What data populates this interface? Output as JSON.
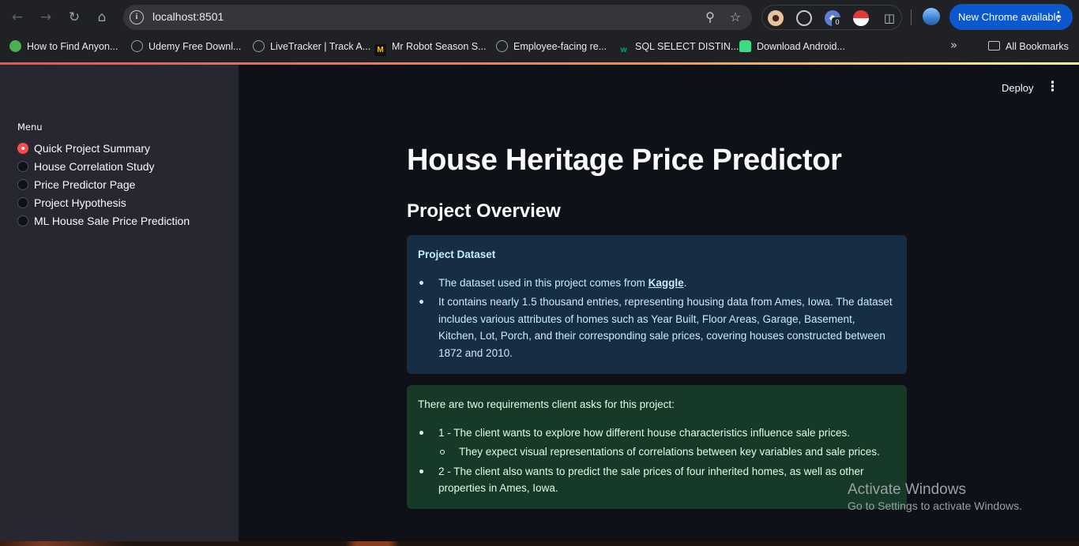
{
  "browser": {
    "url": "localhost:8501",
    "update_label": "New Chrome available",
    "extension_badge": "0",
    "bookmarks": [
      {
        "label": "How to Find Anyon...",
        "icon": "green-logo-icon",
        "color": "#4caf50"
      },
      {
        "label": "Udemy Free Downl...",
        "icon": "globe-icon",
        "color": "#9aa0a6"
      },
      {
        "label": "LiveTracker | Track A...",
        "icon": "globe-icon",
        "color": "#9aa0a6"
      },
      {
        "label": "Mr Robot Season S...",
        "icon": "m-logo-icon",
        "color": "#f4c20d"
      },
      {
        "label": "Employee-facing re...",
        "icon": "globe-icon",
        "color": "#9aa0a6"
      },
      {
        "label": "SQL SELECT DISTIN...",
        "icon": "w3-logo-icon",
        "color": "#04aa6d"
      },
      {
        "label": "Download Android...",
        "icon": "android-icon",
        "color": "#3ddc84"
      }
    ],
    "all_bookmarks_label": "All Bookmarks"
  },
  "sidebar": {
    "menu_title": "Menu",
    "items": [
      {
        "label": "Quick Project Summary",
        "selected": true
      },
      {
        "label": "House Correlation Study",
        "selected": false
      },
      {
        "label": "Price Predictor Page",
        "selected": false
      },
      {
        "label": "Project Hypothesis",
        "selected": false
      },
      {
        "label": "ML House Sale Price Prediction",
        "selected": false
      }
    ]
  },
  "header": {
    "deploy_label": "Deploy"
  },
  "main": {
    "title": "House Heritage Price Predictor",
    "subtitle": "Project Overview",
    "info_box": {
      "heading": "Project Dataset",
      "bullet1_prefix": "The dataset used in this project comes from ",
      "bullet1_link": "Kaggle",
      "bullet1_suffix": ".",
      "bullet2": "It contains nearly 1.5 thousand entries, representing housing data from Ames, Iowa. The dataset includes various attributes of homes such as Year Built, Floor Areas, Garage, Basement, Kitchen, Lot, Porch, and their corresponding sale prices, covering houses constructed between 1872 and 2010."
    },
    "success_box": {
      "intro": "There are two requirements client asks for this project:",
      "req1": "1 - The client wants to explore how different house characteristics influence sale prices.",
      "req1_sub": "They expect visual representations of correlations between key variables and sale prices.",
      "req2": "2 - The client also wants to predict the sale prices of four inherited homes, as well as other properties in Ames, Iowa."
    }
  },
  "watermark": {
    "line1": "Activate Windows",
    "line2": "Go to Settings to activate Windows."
  },
  "colors": {
    "accent": "#ff4b4b",
    "info_bg": "#172d43",
    "success_bg": "#173928",
    "sidebar_bg": "#262730",
    "main_bg": "#0e1117"
  }
}
